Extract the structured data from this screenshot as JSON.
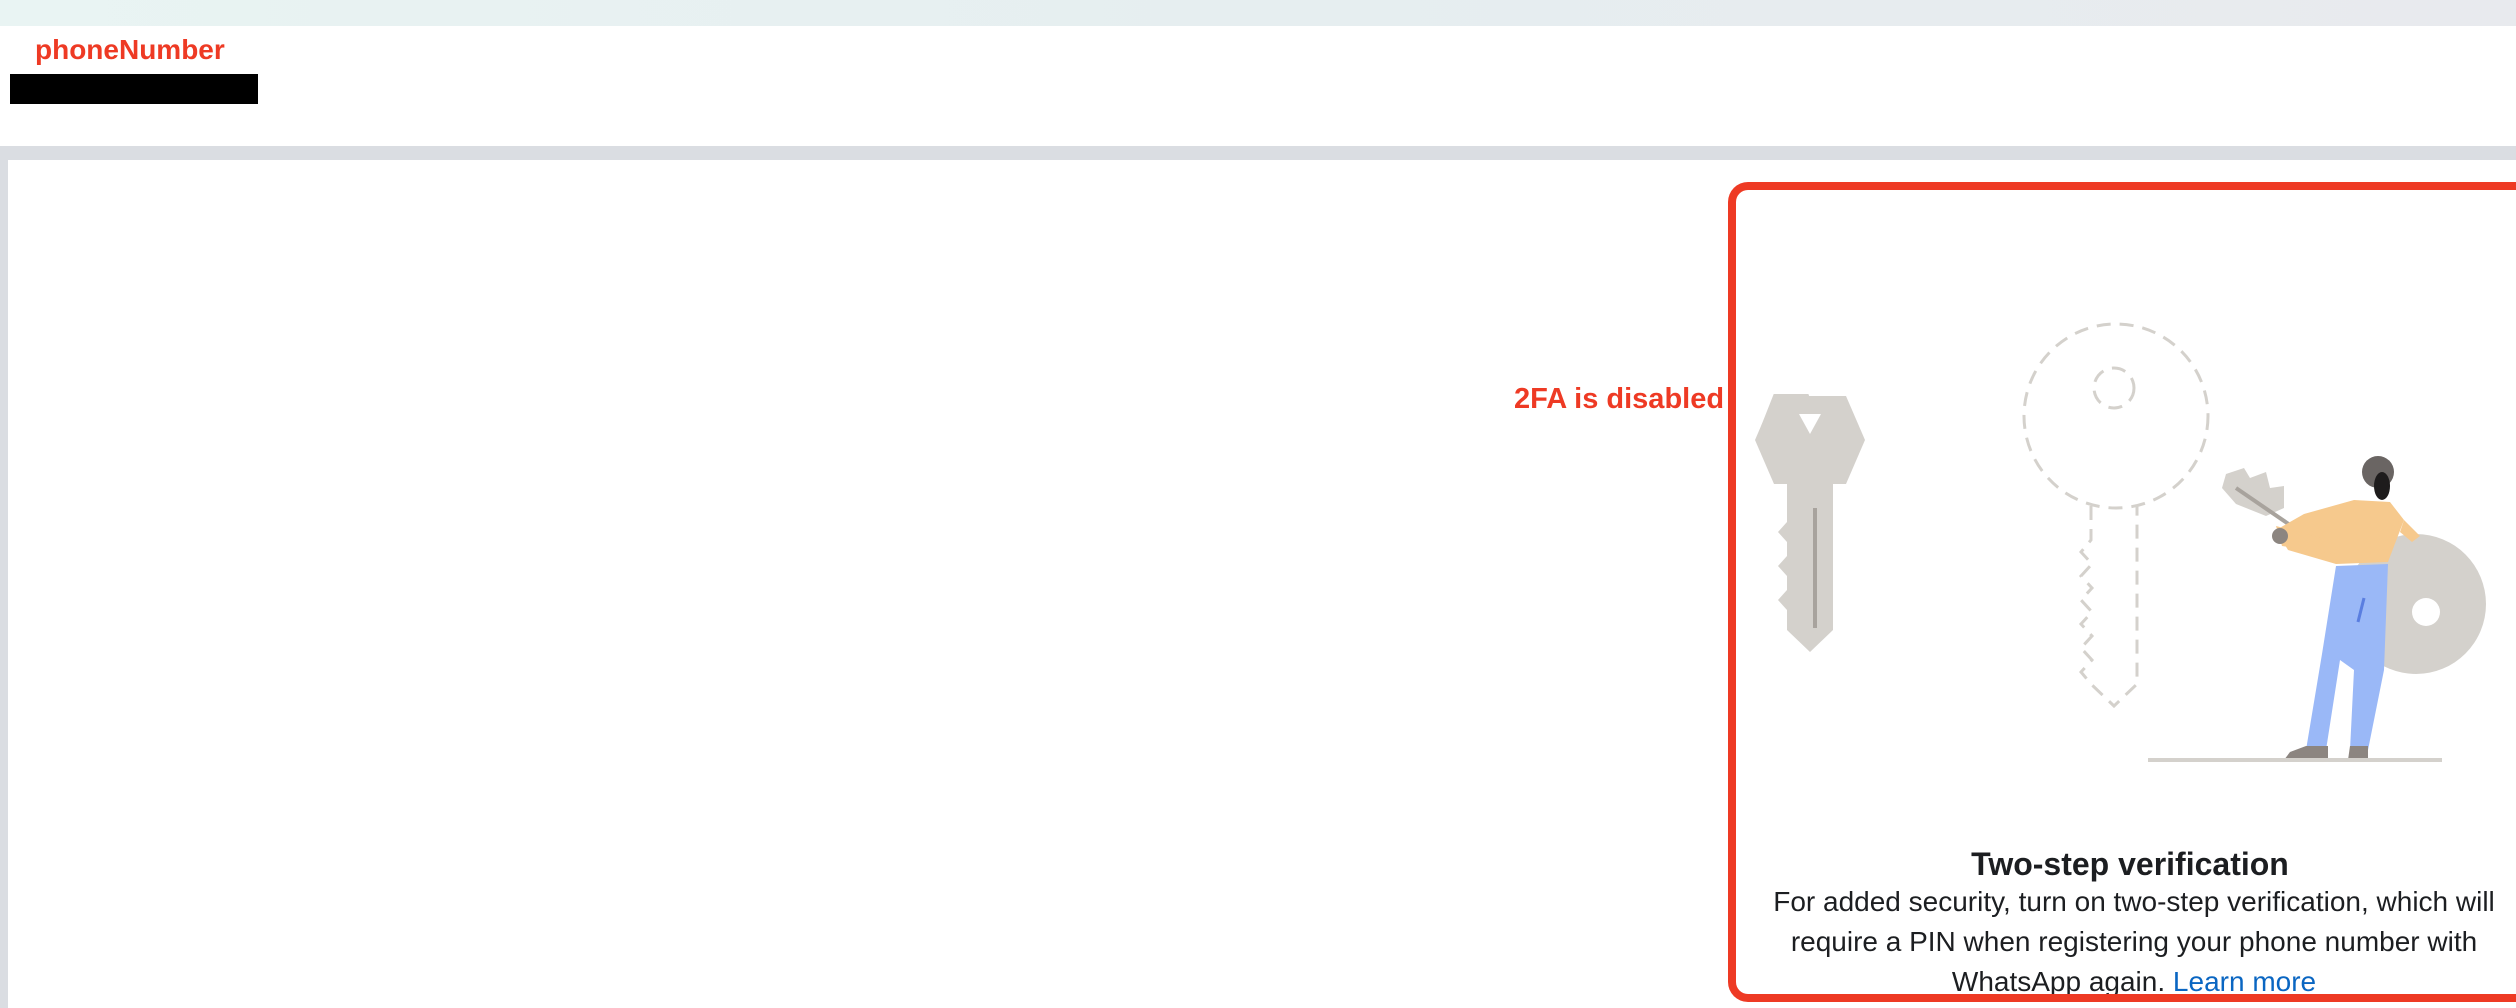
{
  "annotations": {
    "phone_label": "phoneNumber",
    "twofa_label": "2FA is disabled"
  },
  "card": {
    "title": "Two-step verification",
    "body": "For added security, turn on two-step verification, which will require a PIN when registering your phone number with WhatsApp again.",
    "link_label": "Learn more"
  },
  "colors": {
    "annotation": "#ee3a24",
    "link": "#0a66c2",
    "text": "#1c1e21"
  },
  "icons": [
    "key-illustration",
    "dashed-key-illustration",
    "person-holding-key-illustration"
  ]
}
